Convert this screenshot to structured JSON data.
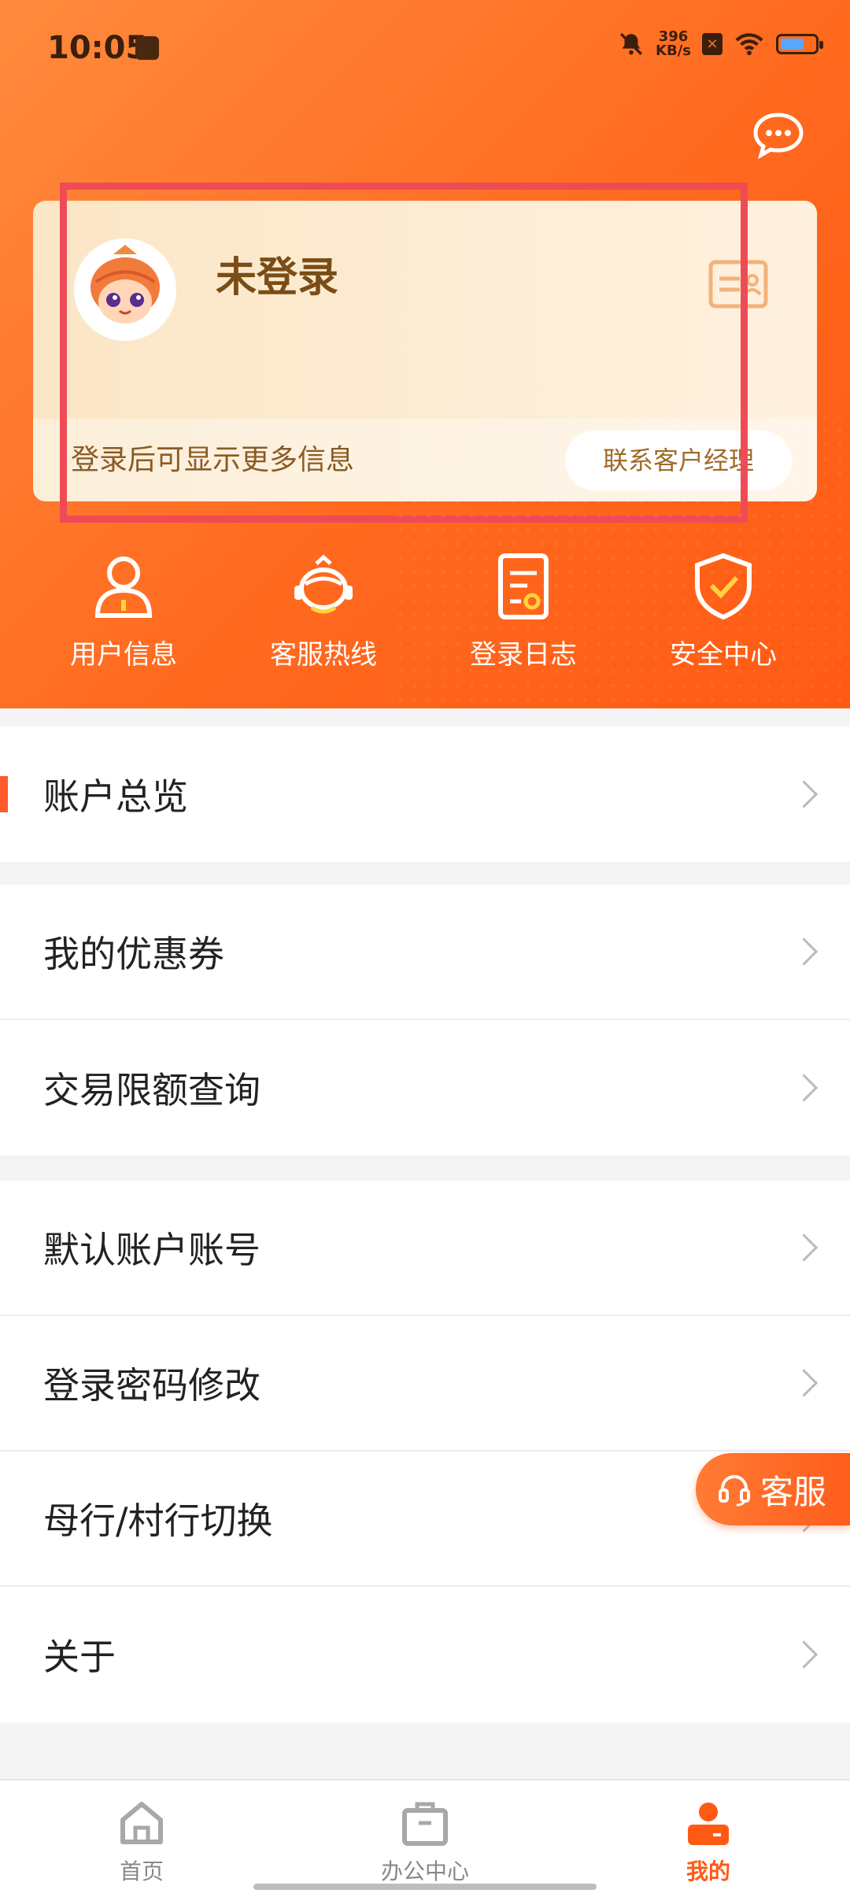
{
  "status_bar": {
    "time": "10:05",
    "speed_value": "396",
    "speed_unit": "KB/s"
  },
  "profile_card": {
    "name": "未登录",
    "hint": "登录后可显示更多信息",
    "contact_button": "联系客户经理"
  },
  "quick_actions": [
    {
      "label": "用户信息",
      "icon": "user-icon"
    },
    {
      "label": "客服热线",
      "icon": "headset-robot-icon"
    },
    {
      "label": "登录日志",
      "icon": "log-document-icon"
    },
    {
      "label": "安全中心",
      "icon": "shield-check-icon"
    }
  ],
  "menu": {
    "group1": [
      {
        "label": "账户总览"
      }
    ],
    "group2": [
      {
        "label": "我的优惠券"
      },
      {
        "label": "交易限额查询"
      }
    ],
    "group3": [
      {
        "label": "默认账户账号"
      },
      {
        "label": "登录密码修改"
      },
      {
        "label": "母行/村行切换"
      },
      {
        "label": "关于"
      }
    ]
  },
  "floating_service": {
    "label": "客服"
  },
  "tabbar": {
    "items": [
      {
        "label": "首页",
        "icon": "home-icon"
      },
      {
        "label": "办公中心",
        "icon": "briefcase-icon"
      },
      {
        "label": "我的",
        "icon": "person-icon"
      }
    ],
    "active": "我的"
  },
  "colors": {
    "accent": "#ff6a1f",
    "card": "#fbe6c6",
    "highlight": "#ef4b56"
  }
}
